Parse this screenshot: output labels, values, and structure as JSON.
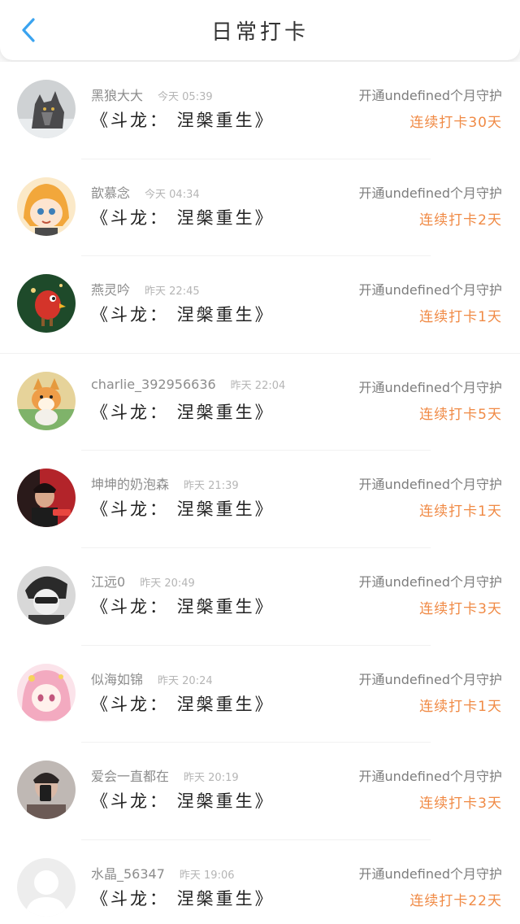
{
  "header": {
    "title": "日常打卡",
    "back_icon": "chevron-left-icon",
    "accent": "#3aa3ef"
  },
  "colors": {
    "streak": "#f08a45",
    "name": "#8c8c8c",
    "time": "#b5b5b5",
    "book": "#222222"
  },
  "entries": [
    {
      "name": "黑狼大大",
      "time": "今天 05:39",
      "book": "《斗龙： 涅槃重生》",
      "guard": "开通undefined个月守护",
      "streak": "连续打卡30天",
      "avatar": "wolf-avatar"
    },
    {
      "name": "歆慕念",
      "time": "今天 04:34",
      "book": "《斗龙： 涅槃重生》",
      "guard": "开通undefined个月守护",
      "streak": "连续打卡2天",
      "avatar": "anime-girl-avatar"
    },
    {
      "name": "燕灵吟",
      "time": "昨天 22:45",
      "book": "《斗龙： 涅槃重生》",
      "guard": "开通undefined个月守护",
      "streak": "连续打卡1天",
      "avatar": "bird-avatar"
    },
    {
      "name": "charlie_392956636",
      "time": "昨天 22:04",
      "book": "《斗龙： 涅槃重生》",
      "guard": "开通undefined个月守护",
      "streak": "连续打卡5天",
      "avatar": "corgi-avatar"
    },
    {
      "name": "坤坤的奶泡森",
      "time": "昨天 21:39",
      "book": "《斗龙： 涅槃重生》",
      "guard": "开通undefined个月守护",
      "streak": "连续打卡1天",
      "avatar": "red-poster-avatar"
    },
    {
      "name": "江远0",
      "time": "昨天 20:49",
      "book": "《斗龙： 涅槃重生》",
      "guard": "开通undefined个月守护",
      "streak": "连续打卡3天",
      "avatar": "monochrome-avatar"
    },
    {
      "name": "似海如锦",
      "time": "昨天 20:24",
      "book": "《斗龙： 涅槃重生》",
      "guard": "开通undefined个月守护",
      "streak": "连续打卡1天",
      "avatar": "pink-anime-avatar"
    },
    {
      "name": "爱会一直都在",
      "time": "昨天 20:19",
      "book": "《斗龙： 涅槃重生》",
      "guard": "开通undefined个月守护",
      "streak": "连续打卡3天",
      "avatar": "selfie-avatar"
    },
    {
      "name": "水晶_56347",
      "time": "昨天 19:06",
      "book": "《斗龙： 涅槃重生》",
      "guard": "开通undefined个月守护",
      "streak": "连续打卡22天",
      "avatar": "default-user-avatar"
    }
  ]
}
